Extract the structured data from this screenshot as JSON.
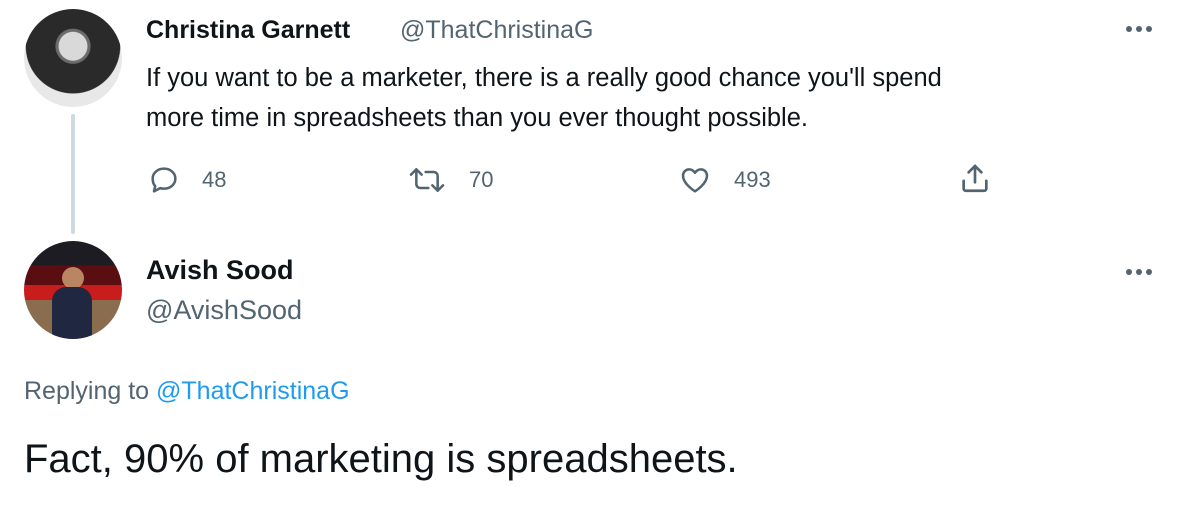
{
  "parent_tweet": {
    "author_name": "Christina Garnett",
    "author_handle": "@ThatChristinaG",
    "text": "If you want to be a marketer, there is a really good chance you'll spend\nmore time in spreadsheets than you ever thought possible.",
    "actions": {
      "replies": "48",
      "retweets": "70",
      "likes": "493"
    },
    "icons": [
      "reply-icon",
      "retweet-icon",
      "like-icon",
      "share-icon",
      "more-icon"
    ]
  },
  "reply_tweet": {
    "author_name": "Avish Sood",
    "author_handle": "@AvishSood",
    "replying_prefix": "Replying to ",
    "replying_handle": "@ThatChristinaG",
    "text": "Fact, 90% of marketing is spreadsheets."
  },
  "colors": {
    "text_primary": "#0f1419",
    "text_secondary": "#536471",
    "link": "#1d9bf0",
    "thread_line": "#cfd9de"
  }
}
